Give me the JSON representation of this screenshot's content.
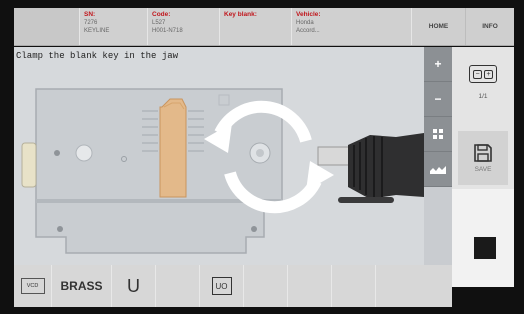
{
  "header": {
    "sn_label": "SN:",
    "sn_value": "7276",
    "sn_value2": "KEYLINE",
    "code_label": "Code:",
    "code_value": "L527",
    "code_value2": "H001-N718",
    "key_blank_label": "Key blank:",
    "vehicle_label": "Vehicle:",
    "vehicle_value": "Honda",
    "vehicle_value2": "Accord...",
    "home_label": "HOME",
    "info_label": "INFO"
  },
  "main": {
    "instruction": "Clamp the blank key in the jaw"
  },
  "toolbar": {
    "zoom_in": "+",
    "zoom_out": "−",
    "grid": "::",
    "grid_icon": "grid-icon",
    "cut_icon": "cut-profile-icon"
  },
  "side": {
    "page_indicator": "1/1",
    "save_label": "SAVE",
    "zoom_icon": "fit-zoom-icon",
    "save_icon": "floppy-disk-icon",
    "stop_icon": "stop-icon"
  },
  "bottom": {
    "logo_text": "VCD",
    "material": "BRASS",
    "profile": "U",
    "profile_code": "UO"
  },
  "colors": {
    "header_label": "#c0151b",
    "key_blank": "#e3b98a",
    "toolbar": "#8c9094"
  }
}
